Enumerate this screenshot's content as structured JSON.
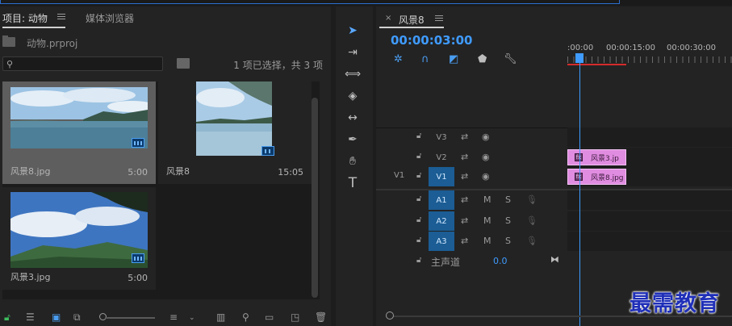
{
  "project": {
    "tab_active": "项目: 动物",
    "tab_media": "媒体浏览器",
    "file": "动物.prproj",
    "search_placeholder": "",
    "selection": "1 项已选择，共 3 项",
    "items": [
      {
        "name": "风景8.jpg",
        "duration": "5:00"
      },
      {
        "name": "风景8",
        "duration": "15:05"
      },
      {
        "name": "风景3.jpg",
        "duration": "5:00"
      }
    ]
  },
  "timeline": {
    "sequence_name": "风景8",
    "timecode": "00:00:03:00",
    "ruler": [
      ":00:00",
      "00:00:15:00",
      "00:00:30:00"
    ],
    "tracks": [
      {
        "src": "",
        "name": "V3",
        "on": false
      },
      {
        "src": "",
        "name": "V2",
        "on": false
      },
      {
        "src": "V1",
        "name": "V1",
        "on": true
      },
      {
        "src": "",
        "name": "A1",
        "on": true
      },
      {
        "src": "",
        "name": "A2",
        "on": true
      },
      {
        "src": "",
        "name": "A3",
        "on": true
      }
    ],
    "audio_m": "M",
    "audio_s": "S",
    "clips": {
      "v2": "风景3.jp",
      "v1": "风景8.jpg"
    },
    "master_label": "主声道",
    "master_value": "0.0"
  },
  "watermark": "最需教育",
  "colors": {
    "accent": "#3f9bff",
    "clip": "#e08ce0",
    "track_on": "#1b5d94"
  }
}
